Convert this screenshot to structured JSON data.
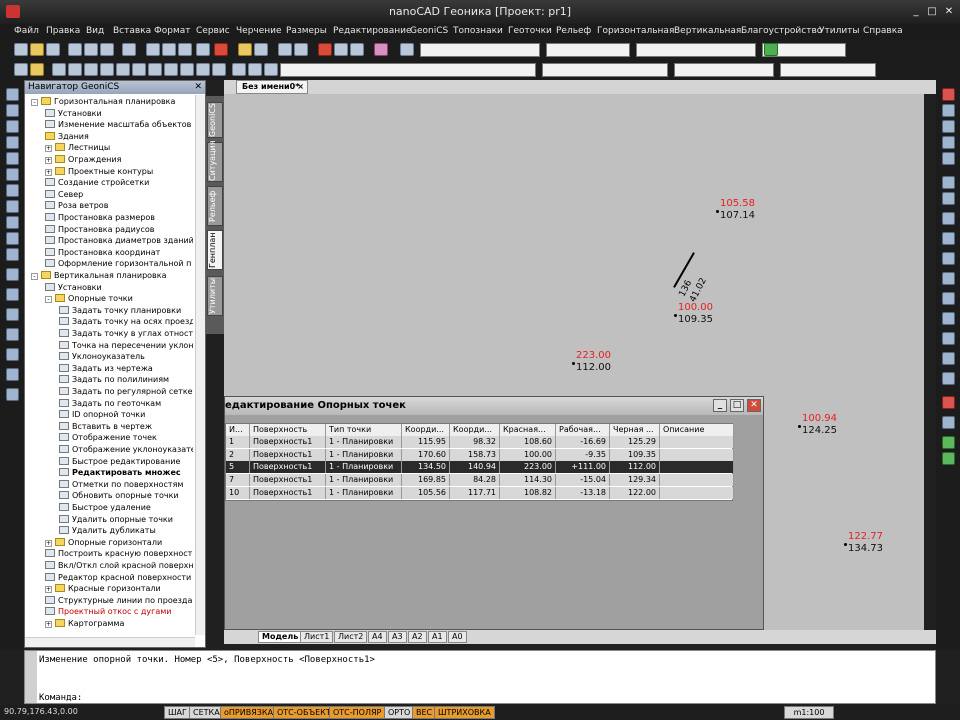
{
  "window": {
    "title": "nanoCAD Геоника [Проект: pr1]"
  },
  "menu": [
    "Файл",
    "Правка",
    "Вид",
    "Вставка",
    "Формат",
    "Сервис",
    "Черчение",
    "Размеры",
    "Редактирование",
    "GeoniCS",
    "Топознаки",
    "Геоточки",
    "Рельеф",
    "Горизонтальная",
    "Вертикальная",
    "Благоустройство",
    "Утилиты",
    "Справка"
  ],
  "navigator": {
    "title": "Навигатор GeoniCS",
    "items": [
      {
        "label": "Горизонтальная планировка",
        "kind": "folder",
        "level": 0,
        "exp": "-"
      },
      {
        "label": "Установки",
        "kind": "tool",
        "level": 1
      },
      {
        "label": "Изменение масштаба объектов",
        "kind": "tool",
        "level": 1
      },
      {
        "label": "Здания",
        "kind": "folder",
        "level": 1
      },
      {
        "label": "Лестницы",
        "kind": "folder",
        "level": 1,
        "exp": "+"
      },
      {
        "label": "Ограждения",
        "kind": "folder",
        "level": 1,
        "exp": "+"
      },
      {
        "label": "Проектные контуры",
        "kind": "folder",
        "level": 1,
        "exp": "+"
      },
      {
        "label": "Создание стройсетки",
        "kind": "tool",
        "level": 1
      },
      {
        "label": "Север",
        "kind": "tool",
        "level": 1
      },
      {
        "label": "Роза ветров",
        "kind": "tool",
        "level": 1
      },
      {
        "label": "Простановка размеров",
        "kind": "tool",
        "level": 1
      },
      {
        "label": "Простановка радиусов",
        "kind": "tool",
        "level": 1
      },
      {
        "label": "Простановка диаметров зданий",
        "kind": "tool",
        "level": 1
      },
      {
        "label": "Простановка координат",
        "kind": "tool",
        "level": 1
      },
      {
        "label": "Оформление горизонтальной п",
        "kind": "tool",
        "level": 1
      },
      {
        "label": "Вертикальная планировка",
        "kind": "folder",
        "level": 0,
        "exp": "-"
      },
      {
        "label": "Установки",
        "kind": "tool",
        "level": 1
      },
      {
        "label": "Опорные точки",
        "kind": "folder",
        "level": 1,
        "exp": "-"
      },
      {
        "label": "Задать точку планировки",
        "kind": "tool",
        "level": 2
      },
      {
        "label": "Задать точку на осях проезд",
        "kind": "tool",
        "level": 2
      },
      {
        "label": "Задать точку в углах отност",
        "kind": "tool",
        "level": 2
      },
      {
        "label": "Точка на пересечении уклон",
        "kind": "tool",
        "level": 2
      },
      {
        "label": "Уклоноуказатель",
        "kind": "tool",
        "level": 2
      },
      {
        "label": "Задать из чертежа",
        "kind": "tool",
        "level": 2
      },
      {
        "label": "Задать по полилиниям",
        "kind": "tool",
        "level": 2
      },
      {
        "label": "Задать по регулярной сетке",
        "kind": "tool",
        "level": 2
      },
      {
        "label": "Задать по геоточкам",
        "kind": "tool",
        "level": 2
      },
      {
        "label": "ID опорной точки",
        "kind": "tool",
        "level": 2
      },
      {
        "label": "Вставить в чертеж",
        "kind": "tool",
        "level": 2
      },
      {
        "label": "Отображение точек",
        "kind": "tool",
        "level": 2
      },
      {
        "label": "Отображение уклоноуказате",
        "kind": "tool",
        "level": 2
      },
      {
        "label": "Быстрое редактирование",
        "kind": "tool",
        "level": 2
      },
      {
        "label": "Редактировать множес",
        "kind": "tool",
        "level": 2,
        "bold": true
      },
      {
        "label": "Отметки по поверхностям",
        "kind": "tool",
        "level": 2
      },
      {
        "label": "Обновить опорные точки",
        "kind": "tool",
        "level": 2
      },
      {
        "label": "Быстрое удаление",
        "kind": "tool",
        "level": 2
      },
      {
        "label": "Удалить опорные точки",
        "kind": "tool",
        "level": 2
      },
      {
        "label": "Удалить дубликаты",
        "kind": "tool",
        "level": 2
      },
      {
        "label": "Опорные горизонтали",
        "kind": "folder",
        "level": 1,
        "exp": "+"
      },
      {
        "label": "Построить красную поверхност",
        "kind": "tool",
        "level": 1
      },
      {
        "label": "Вкл/Откл слой красной поверхн",
        "kind": "tool",
        "level": 1
      },
      {
        "label": "Редактор красной поверхности",
        "kind": "tool",
        "level": 1
      },
      {
        "label": "Красные горизонтали",
        "kind": "folder",
        "level": 1,
        "exp": "+"
      },
      {
        "label": "Структурные линии по проездам",
        "kind": "tool",
        "level": 1
      },
      {
        "label": "Проектный откос с дугами",
        "kind": "tool",
        "level": 1,
        "red": true
      },
      {
        "label": "Картограмма",
        "kind": "folder",
        "level": 1,
        "exp": "+"
      }
    ]
  },
  "vtabs": [
    "GeoniCS",
    "Ситуация",
    "Рельеф",
    "Генплан",
    "Утилиты"
  ],
  "document": {
    "tab_label": "Без имени0*",
    "close": "×"
  },
  "drawing_points": [
    {
      "red": "105.58",
      "black": "107.14"
    },
    {
      "red": "100.00",
      "black": "109.35"
    },
    {
      "red": "223.00",
      "black": "112.00"
    },
    {
      "red": "100.94",
      "black": "124.25"
    },
    {
      "red": "122.77",
      "black": "134.73"
    }
  ],
  "slope_label": {
    "top": "136",
    "bottom": "41.02"
  },
  "dialog": {
    "title": "едактирование Опорных точек",
    "columns": [
      "И...",
      "Поверхность",
      "Тип точки",
      "Коорди...",
      "Коорди...",
      "Красная...",
      "Рабочая...",
      "Черная ...",
      "Описание"
    ],
    "rows": [
      [
        "1",
        "Поверхность1",
        "1 - Планировки",
        "115.95",
        "98.32",
        "108.60",
        "-16.69",
        "125.29",
        ""
      ],
      [
        "2",
        "Поверхность1",
        "1 - Планировки",
        "170.60",
        "158.73",
        "100.00",
        "-9.35",
        "109.35",
        ""
      ],
      [
        "5",
        "Поверхность1",
        "1 - Планировки",
        "134.50",
        "140.94",
        "223.00",
        "+111.00",
        "112.00",
        ""
      ],
      [
        "7",
        "Поверхность1",
        "1 - Планировки",
        "169.85",
        "84.28",
        "114.30",
        "-15.04",
        "129.34",
        ""
      ],
      [
        "10",
        "Поверхность1",
        "1 - Планировки",
        "105.56",
        "117.71",
        "108.82",
        "-13.18",
        "122.00",
        ""
      ]
    ],
    "selected_row": 2
  },
  "sheets": [
    "Модель",
    "Лист1",
    "Лист2",
    "A4",
    "A3",
    "A2",
    "A1",
    "A0"
  ],
  "command": {
    "line1": "Изменение опорной точки. Номер <5>, Поверхность <Поверхность1>",
    "line2": "Команда:"
  },
  "status": {
    "coords": "90.79,176.43,0.00",
    "buttons": [
      {
        "label": "ШАГ",
        "on": false
      },
      {
        "label": "СЕТКА",
        "on": false
      },
      {
        "label": "оПРИВЯЗКА",
        "on": true
      },
      {
        "label": "ОТС-ОБЪЕКТ",
        "on": true
      },
      {
        "label": "ОТС-ПОЛЯР",
        "on": true
      },
      {
        "label": "ОРТО",
        "on": false
      },
      {
        "label": "ВЕС",
        "on": true
      },
      {
        "label": "ШТРИХОВКА",
        "on": true
      }
    ],
    "scale": "m1:100"
  },
  "colors": {
    "accent_status_on": "#e89b2e",
    "point_red": "#e82020",
    "canvas": "#c0c0c0"
  }
}
